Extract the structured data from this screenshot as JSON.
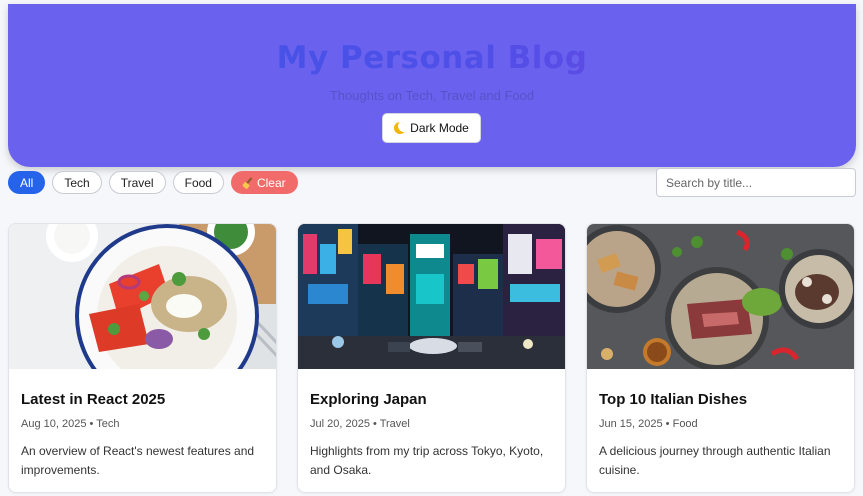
{
  "header": {
    "title": "My Personal Blog",
    "subtitle": "Thoughts on Tech, Travel and Food",
    "dark_mode_label": "Dark Mode",
    "background_color": "#6a62ee"
  },
  "filters": {
    "items": [
      {
        "label": "All",
        "active": true
      },
      {
        "label": "Tech",
        "active": false
      },
      {
        "label": "Travel",
        "active": false
      },
      {
        "label": "Food",
        "active": false
      }
    ],
    "clear_label": "Clear",
    "clear_color": "#f26b6b",
    "active_color": "#2563eb"
  },
  "search": {
    "placeholder": "Search by title...",
    "value": ""
  },
  "posts": [
    {
      "title": "Latest in React 2025",
      "date": "Aug 10, 2025",
      "category": "Tech",
      "description": "An overview of React's newest features and improvements.",
      "image": "food-bowl-photo"
    },
    {
      "title": "Exploring Japan",
      "date": "Jul 20, 2025",
      "category": "Travel",
      "description": "Highlights from my trip across Tokyo, Kyoto, and Osaka.",
      "image": "tokyo-street-photo"
    },
    {
      "title": "Top 10 Italian Dishes",
      "date": "Jun 15, 2025",
      "category": "Food",
      "description": "A delicious journey through authentic Italian cuisine.",
      "image": "italian-dishes-photo"
    }
  ]
}
